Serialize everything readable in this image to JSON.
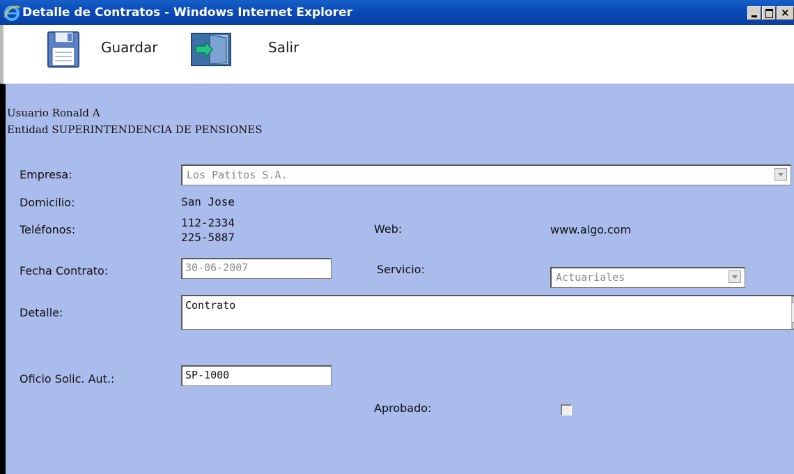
{
  "window": {
    "title": "Detalle de Contratos - Windows Internet Explorer"
  },
  "toolbar": {
    "save_label": "Guardar",
    "exit_label": "Salir"
  },
  "session": {
    "user_line": "Usuario Ronald A",
    "entity_line": "Entidad SUPERINTENDENCIA DE PENSIONES"
  },
  "form": {
    "empresa_label": "Empresa:",
    "empresa_value": "Los Patitos S.A.",
    "domicilio_label": "Domicilio:",
    "domicilio_value": "San Jose",
    "telefonos_label": "Teléfonos:",
    "telefonos_values": [
      "112-2334",
      "225-5887"
    ],
    "web_label": "Web:",
    "web_value": "www.algo.com",
    "fecha_label": "Fecha Contrato:",
    "fecha_value": "30-06-2007",
    "servicio_label": "Servicio:",
    "servicio_value": "Actuariales",
    "detalle_label": "Detalle:",
    "detalle_value": "Contrato",
    "oficio_label": "Oficio Solic. Aut.:",
    "oficio_value": "SP-1000",
    "aprobado_label": "Aprobado:",
    "aprobado_checked": false
  },
  "icons": {
    "browser": "ie-logo-icon",
    "save": "floppy-disk-icon",
    "exit": "exit-door-icon"
  }
}
